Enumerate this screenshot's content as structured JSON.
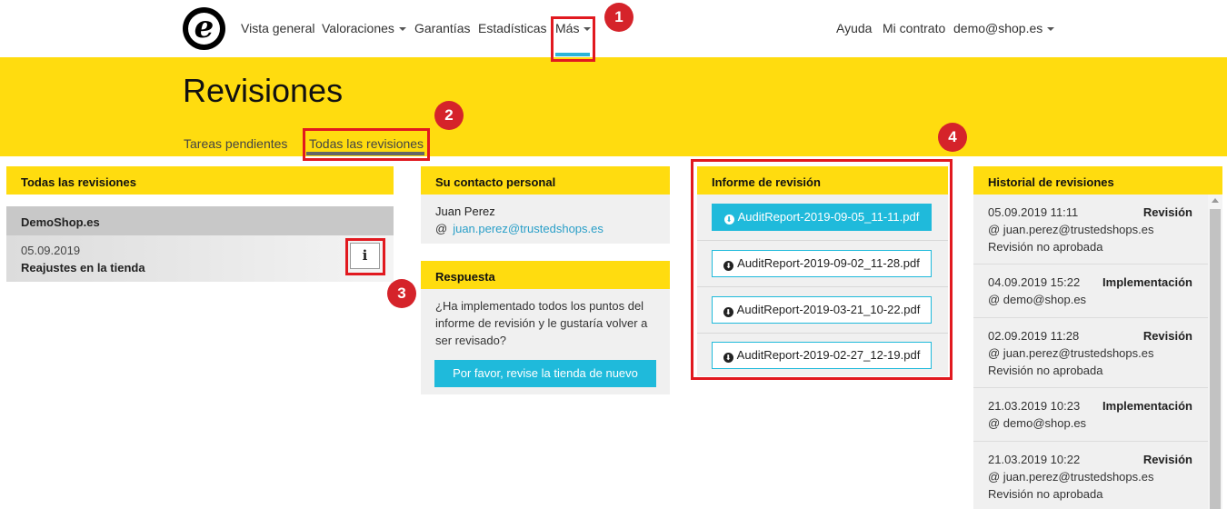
{
  "nav": {
    "logo_letter": "e",
    "items": [
      {
        "label": "Vista general"
      },
      {
        "label": "Valoraciones"
      },
      {
        "label": "Garantías"
      },
      {
        "label": "Estadísticas"
      },
      {
        "label": "Más"
      }
    ],
    "right": [
      {
        "label": "Ayuda"
      },
      {
        "label": "Mi contrato"
      },
      {
        "label": "demo@shop.es"
      }
    ]
  },
  "annotations": [
    "1",
    "2",
    "3",
    "4"
  ],
  "header": {
    "title": "Revisiones",
    "tabs": [
      {
        "label": "Tareas pendientes"
      },
      {
        "label": "Todas las revisiones"
      }
    ]
  },
  "all_reviews": {
    "title": "Todas las revisiones",
    "group": "DemoShop.es",
    "item": {
      "date": "05.09.2019",
      "desc": "Reajustes en la tienda",
      "info_icon": "i"
    }
  },
  "contact": {
    "title": "Su contacto personal",
    "name": "Juan Perez",
    "at": "@",
    "email": "juan.perez@trustedshops.es"
  },
  "response": {
    "title": "Respuesta",
    "text": "¿Ha implementado todos los puntos del informe de revisión y le gustaría volver a ser revisado?",
    "button": "Por favor, revise la tienda de nuevo"
  },
  "report": {
    "title": "Informe de revisión",
    "files": [
      "AuditReport-2019-09-05_11-11.pdf",
      "AuditReport-2019-09-02_11-28.pdf",
      "AuditReport-2019-03-21_10-22.pdf",
      "AuditReport-2019-02-27_12-19.pdf"
    ]
  },
  "history": {
    "title": "Historial de revisiones",
    "items": [
      {
        "date": "05.09.2019 11:11",
        "type": "Revisión",
        "user": "@ juan.perez@trustedshops.es",
        "status": "Revisión no aprobada"
      },
      {
        "date": "04.09.2019 15:22",
        "type": "Implementación",
        "user": "@ demo@shop.es",
        "status": ""
      },
      {
        "date": "02.09.2019 11:28",
        "type": "Revisión",
        "user": "@ juan.perez@trustedshops.es",
        "status": "Revisión no aprobada"
      },
      {
        "date": "21.03.2019 10:23",
        "type": "Implementación",
        "user": "@ demo@shop.es",
        "status": ""
      },
      {
        "date": "21.03.2019 10:22",
        "type": "Revisión",
        "user": "@ juan.perez@trustedshops.es",
        "status": "Revisión no aprobada"
      }
    ]
  },
  "colors": {
    "brand_yellow": "#ffdc0f",
    "accent_blue": "#1fbadb",
    "annotation_red": "#d5232a"
  }
}
